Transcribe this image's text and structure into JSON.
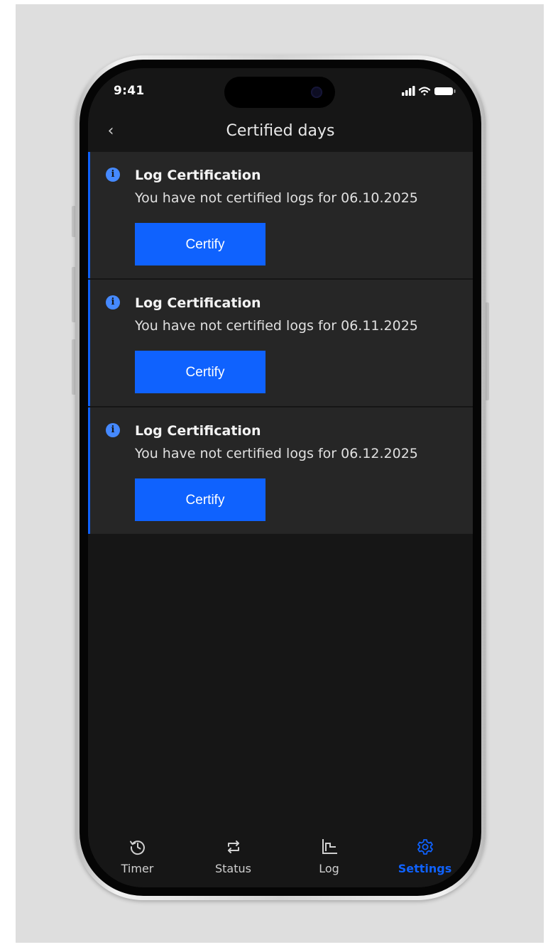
{
  "status_bar": {
    "time": "9:41"
  },
  "header": {
    "back_label": "‹",
    "title": "Certified days"
  },
  "cards": [
    {
      "title": "Log Certification",
      "message": "You have not certified logs for 06.10.2025",
      "button_label": "Certify"
    },
    {
      "title": "Log Certification",
      "message": "You have not certified logs for 06.11.2025",
      "button_label": "Certify"
    },
    {
      "title": "Log Certification",
      "message": "You have not certified logs for 06.12.2025",
      "button_label": "Certify"
    }
  ],
  "info_icon_glyph": "i",
  "tabs": [
    {
      "label": "Timer",
      "icon": "history-clock-icon",
      "active": false
    },
    {
      "label": "Status",
      "icon": "swap-arrows-icon",
      "active": false
    },
    {
      "label": "Log",
      "icon": "log-chart-icon",
      "active": false
    },
    {
      "label": "Settings",
      "icon": "gear-icon",
      "active": true
    }
  ],
  "colors": {
    "accent": "#0f62fe",
    "info": "#4589ff",
    "background": "#161616",
    "card": "#262626"
  }
}
